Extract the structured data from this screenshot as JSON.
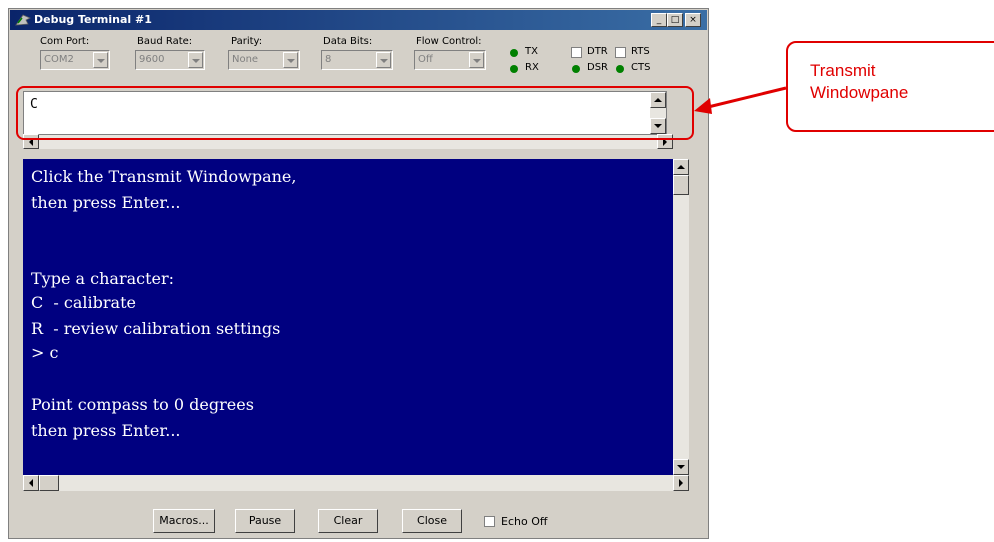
{
  "window": {
    "title": "Debug Terminal #1",
    "controls": {
      "minimize": "_",
      "maximize": "□",
      "close": "×"
    }
  },
  "settings": {
    "com_port": {
      "label": "Com Port:",
      "value": "COM2"
    },
    "baud_rate": {
      "label": "Baud Rate:",
      "value": "9600"
    },
    "parity": {
      "label": "Parity:",
      "value": "None"
    },
    "data_bits": {
      "label": "Data Bits:",
      "value": "8"
    },
    "flow_control": {
      "label": "Flow Control:",
      "value": "Off"
    }
  },
  "signals": {
    "tx": "TX",
    "rx": "RX",
    "dtr": "DTR",
    "rts": "RTS",
    "dsr": "DSR",
    "cts": "CTS",
    "led_color": "#008000"
  },
  "transmit": {
    "text": "C"
  },
  "receive": {
    "lines": [
      "Click the Transmit Windowpane,",
      "then press Enter...",
      "",
      "",
      "Type a character:",
      "C  - calibrate",
      "R  - review calibration settings",
      "> c",
      "",
      "Point compass to 0 degrees",
      "then press Enter..."
    ],
    "background": "#000080"
  },
  "buttons": {
    "macros": "Macros...",
    "pause": "Pause",
    "clear": "Clear",
    "close": "Close",
    "echo_off": "Echo Off"
  },
  "annotation": {
    "line1": "Transmit",
    "line2": "Windowpane",
    "color": "#e00000"
  }
}
